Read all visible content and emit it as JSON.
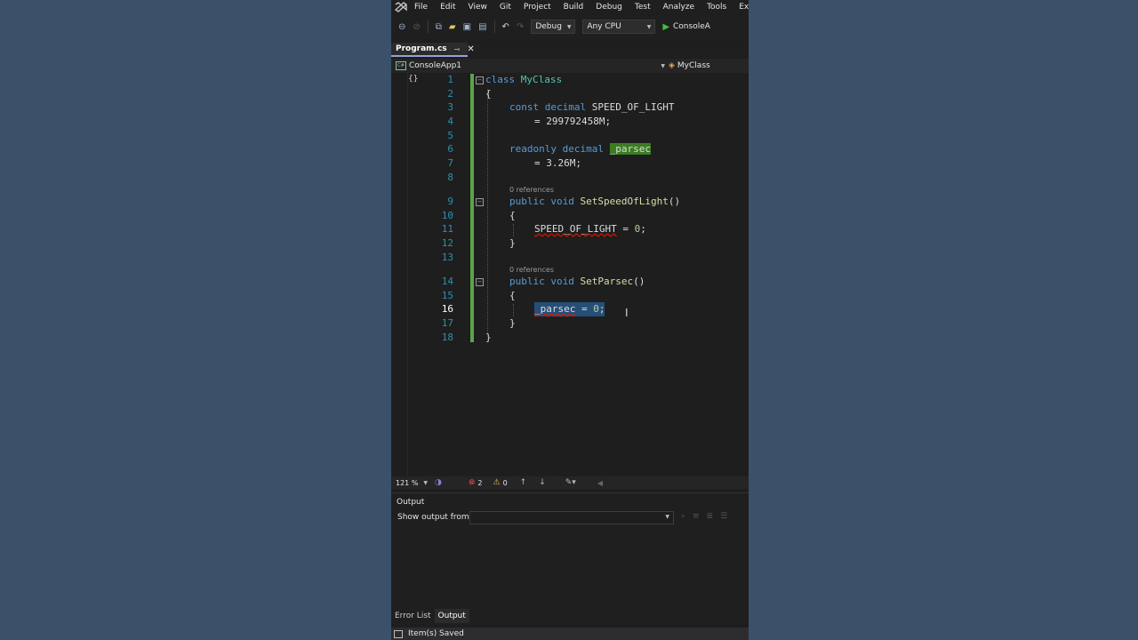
{
  "menu": [
    "File",
    "Edit",
    "View",
    "Git",
    "Project",
    "Build",
    "Debug",
    "Test",
    "Analyze",
    "Tools",
    "Exter"
  ],
  "toolbar": {
    "config": "Debug",
    "platform": "Any CPU",
    "run_label": "ConsoleA"
  },
  "tab": {
    "name": "Program.cs"
  },
  "navbar": {
    "project": "ConsoleApp1",
    "member": "MyClass"
  },
  "editor": {
    "line_numbers": [
      "1",
      "2",
      "3",
      "4",
      "5",
      "6",
      "7",
      "8",
      "9",
      "10",
      "11",
      "12",
      "13",
      "14",
      "15",
      "16",
      "17",
      "18"
    ],
    "current_line": "16",
    "code": {
      "l1_kw": "class",
      "l1_name": "MyClass",
      "l2": "{",
      "l3_kw": "const",
      "l3_type": "decimal",
      "l3_name": "SPEED_OF_LIGHT",
      "l4": "= 299792458M;",
      "l6_kw": "readonly",
      "l6_type": "decimal",
      "l6_name": "_parsec",
      "l7": "= 3.26M;",
      "ref1": "0 references",
      "l9_kw1": "public",
      "l9_kw2": "void",
      "l9_fn": "SetSpeedOfLight",
      "l9_tail": "()",
      "l10": "{",
      "l11_name": "SPEED_OF_LIGHT",
      "l11_op": " = ",
      "l11_num": "0",
      "l11_end": ";",
      "l12": "}",
      "ref2": "0 references",
      "l14_kw1": "public",
      "l14_kw2": "void",
      "l14_fn": "SetParsec",
      "l14_tail": "()",
      "l15": "{",
      "l16_name": "_parsec",
      "l16_op": " = ",
      "l16_num": "0",
      "l16_end": ";",
      "l17": "}",
      "l18": "}"
    }
  },
  "editor_status": {
    "zoom": "121 %",
    "errors": "2",
    "warnings": "0"
  },
  "output": {
    "title": "Output",
    "show_from": "Show output from:"
  },
  "bottom_tabs": [
    "Error List",
    "Output"
  ],
  "status": {
    "text": "Item(s) Saved"
  },
  "colors": {
    "background": "#3b5069",
    "editor": "#1e1e1e",
    "keyword": "#569cd6",
    "type": "#4ec9b0",
    "method": "#dcdcaa",
    "number": "#b5cea8",
    "line_number": "#2b91af",
    "change_bar": "#57a64a",
    "selection": "#264f78"
  }
}
